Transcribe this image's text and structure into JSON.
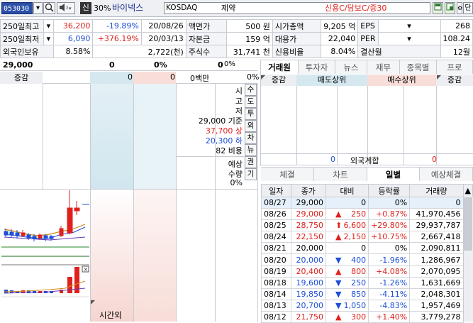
{
  "toolbar": {
    "code": "053030",
    "mark_label": "신",
    "margin_rate": "30%",
    "stock_name": "바이넥스",
    "market": "KOSDAQ",
    "sector": "제약",
    "credit_status": "신용C/담보C/증30",
    "btn_single": "단"
  },
  "info_rows": [
    {
      "c1": "250일최고",
      "c2": "36,200",
      "c3": "-19.89%",
      "c4": "20/08/26",
      "c5": "액면가",
      "c6": "500 원",
      "c7": "시가총액",
      "c8": "9,205 억",
      "c9": "EPS",
      "c10": "268"
    },
    {
      "c1": "250일최저",
      "c2": "6,090",
      "c3": "+376.19%",
      "c4": "20/03/13",
      "c5": "자본금",
      "c6": "159 억",
      "c7": "대용가",
      "c8": "22,040",
      "c9": "PER",
      "c10": "108.24"
    },
    {
      "c1": "외국인보유",
      "c2": "8.58%",
      "c3": "",
      "c4": "2,722(천)",
      "c5": "주식수",
      "c6": "31,741 천",
      "c7": "신용비율",
      "c8": "8.04%",
      "c9": "결산월",
      "c10": "12월"
    }
  ],
  "quote": {
    "price": "29,000",
    "change": "0",
    "rate": "0%",
    "volume": "0",
    "vol_rate": "0%",
    "row2_label": "증감",
    "row2_v1": "0",
    "row2_v2": "0",
    "row2_amount": "0백만",
    "row2_pct": "0%"
  },
  "price_labels": {
    "l1": "시",
    "l2": "고",
    "l3": "저",
    "base": "29,000 기준",
    "upper": "37,700 상",
    "lower": "20,300 하",
    "ratio": "82 비용",
    "exp": "예상",
    "exp_qty": "수량",
    "exp_pct": "0%",
    "time_out": "시간외"
  },
  "side_buttons": [
    "수",
    "도",
    "투",
    "외",
    "차",
    "뉴",
    "권",
    "기"
  ],
  "broker": {
    "tabs": [
      "거래원",
      "투자자",
      "뉴스",
      "재무",
      "종목별",
      "프로"
    ],
    "headers": [
      "증감",
      "매도상위",
      "매수상위",
      "증감"
    ],
    "foreign_label": "외국계합",
    "foreign_sell": "0",
    "foreign_buy": "0"
  },
  "lower_tabs": [
    "체결",
    "차트",
    "일별",
    "예상체결"
  ],
  "daily": {
    "headers": [
      "일자",
      "종가",
      "대비",
      "등락률",
      "거래량"
    ],
    "rows": [
      {
        "date": "08/27",
        "close": "29,000",
        "arrow": "",
        "diff": "0",
        "rate": "0%",
        "vol": "0",
        "dir": "flat"
      },
      {
        "date": "08/26",
        "close": "29,000",
        "arrow": "▲",
        "diff": "250",
        "rate": "+0.87%",
        "vol": "41,970,456",
        "dir": "up"
      },
      {
        "date": "08/25",
        "close": "28,750",
        "arrow": "⬆",
        "diff": "6,600",
        "rate": "+29.80%",
        "vol": "29,937,787",
        "dir": "up"
      },
      {
        "date": "08/24",
        "close": "22,150",
        "arrow": "▲",
        "diff": "2,150",
        "rate": "+10.75%",
        "vol": "2,667,418",
        "dir": "up"
      },
      {
        "date": "08/21",
        "close": "20,000",
        "arrow": "",
        "diff": "0",
        "rate": "0%",
        "vol": "2,090,811",
        "dir": "flat"
      },
      {
        "date": "08/20",
        "close": "20,000",
        "arrow": "▼",
        "diff": "400",
        "rate": "-1.96%",
        "vol": "1,286,967",
        "dir": "down"
      },
      {
        "date": "08/19",
        "close": "20,400",
        "arrow": "▲",
        "diff": "800",
        "rate": "+4.08%",
        "vol": "2,070,095",
        "dir": "up"
      },
      {
        "date": "08/18",
        "close": "19,600",
        "arrow": "▼",
        "diff": "250",
        "rate": "-1.26%",
        "vol": "1,631,669",
        "dir": "down"
      },
      {
        "date": "08/14",
        "close": "19,850",
        "arrow": "▼",
        "diff": "850",
        "rate": "-4.11%",
        "vol": "2,048,301",
        "dir": "down"
      },
      {
        "date": "08/13",
        "close": "20,700",
        "arrow": "▼",
        "diff": "1,050",
        "rate": "-4.83%",
        "vol": "1,957,469",
        "dir": "down"
      },
      {
        "date": "08/12",
        "close": "21,750",
        "arrow": "▲",
        "diff": "300",
        "rate": "+1.40%",
        "vol": "3,779,278",
        "dir": "up"
      }
    ]
  },
  "colors": {
    "up": "#e0201c",
    "down": "#1c4fd8",
    "sell_bg": "#d5e8f0",
    "buy_bg": "#f8ddd8",
    "accent": "#2a4fa8"
  }
}
